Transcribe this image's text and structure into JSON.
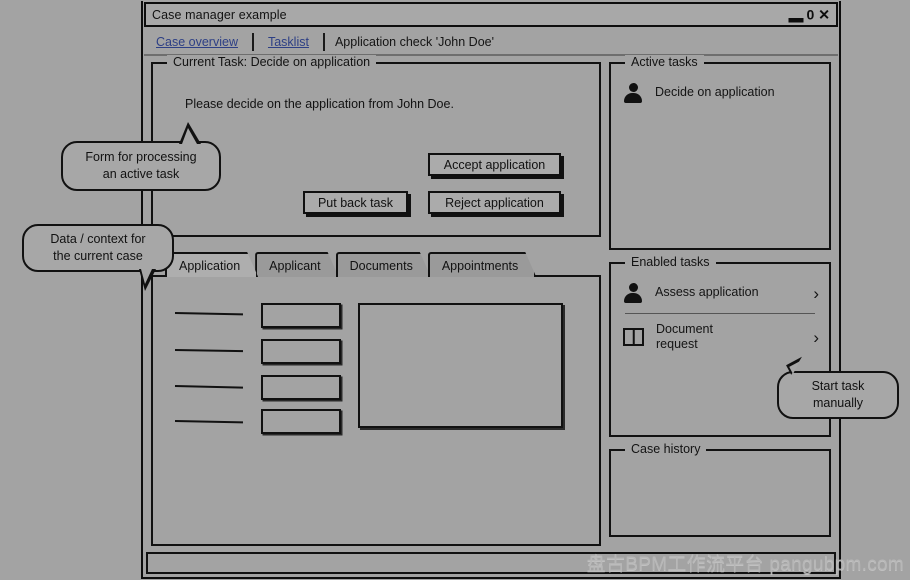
{
  "window": {
    "title": "Case manager example",
    "controls": [
      {
        "name": "minimize",
        "glyph": "▬"
      },
      {
        "name": "maximize",
        "glyph": "0"
      },
      {
        "name": "close",
        "glyph": "✕"
      }
    ]
  },
  "breadcrumb": {
    "link1": "Case overview",
    "link2": "Tasklist",
    "current": "Application check 'John Doe'"
  },
  "current_task": {
    "legend": "Current Task: Decide on application",
    "description": "Please decide on the application from John Doe.",
    "buttons": {
      "accept": "Accept application",
      "reject": "Reject application",
      "put_back": "Put back task"
    }
  },
  "tabs": [
    {
      "label": "Application",
      "active": true
    },
    {
      "label": "Applicant",
      "active": false
    },
    {
      "label": "Documents",
      "active": false
    },
    {
      "label": "Appointments",
      "active": false
    }
  ],
  "active_tasks": {
    "legend": "Active tasks",
    "items": [
      {
        "label": "Decide on application",
        "icon": "person-icon"
      }
    ]
  },
  "enabled_tasks": {
    "legend": "Enabled tasks",
    "items": [
      {
        "label": "Assess application",
        "icon": "person-icon",
        "chevron": "›"
      },
      {
        "label": "Document\nrequest",
        "icon": "document-icon",
        "chevron": "›"
      }
    ]
  },
  "case_history": {
    "legend": "Case history"
  },
  "callouts": [
    {
      "id": "form",
      "text": "Form for processing\nan active task"
    },
    {
      "id": "data",
      "text": "Data / context for\nthe current case"
    },
    {
      "id": "start",
      "text": "Start task\nmanually"
    }
  ],
  "watermark": "盘古BPM工作流平台 pangubpm.com",
  "colors": {
    "background": "#a3a3a3",
    "ink": "#111111",
    "link": "#2d3f85",
    "button_face": "#ababab",
    "tab_inactive": "#9a9a9a",
    "tab_active": "#aeaeae",
    "watermark": "#b9b9b9"
  }
}
